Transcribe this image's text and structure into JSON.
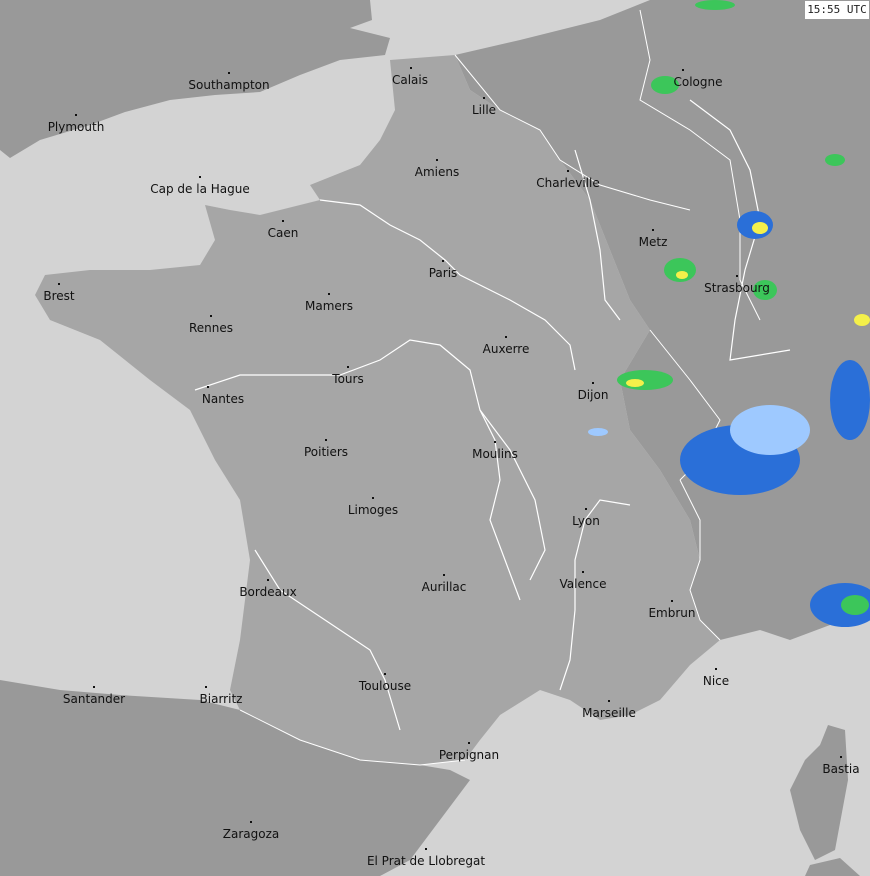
{
  "timestamp": "15:55 UTC",
  "colors": {
    "sea": "#d3d3d3",
    "france": "#a6a6a6",
    "neighbors": "#999999",
    "rivers": "#ffffff",
    "borders": "#ffffff",
    "radar_light": "#9ec9ff",
    "radar_mid": "#2a6fd8",
    "radar_green": "#3cc65a",
    "radar_yellow": "#f4f04a"
  },
  "cities": [
    {
      "id": "southampton",
      "name": "Southampton"
    },
    {
      "id": "plymouth",
      "name": "Plymouth"
    },
    {
      "id": "calais",
      "name": "Calais"
    },
    {
      "id": "lille",
      "name": "Lille"
    },
    {
      "id": "cologne",
      "name": "Cologne"
    },
    {
      "id": "amiens",
      "name": "Amiens"
    },
    {
      "id": "charleville",
      "name": "Charleville"
    },
    {
      "id": "cap-de-la-hague",
      "name": "Cap de la Hague"
    },
    {
      "id": "caen",
      "name": "Caen"
    },
    {
      "id": "metz",
      "name": "Metz"
    },
    {
      "id": "paris",
      "name": "Paris"
    },
    {
      "id": "strasbourg",
      "name": "Strasbourg"
    },
    {
      "id": "brest",
      "name": "Brest"
    },
    {
      "id": "mamers",
      "name": "Mamers"
    },
    {
      "id": "rennes",
      "name": "Rennes"
    },
    {
      "id": "auxerre",
      "name": "Auxerre"
    },
    {
      "id": "tours",
      "name": "Tours"
    },
    {
      "id": "dijon",
      "name": "Dijon"
    },
    {
      "id": "nantes",
      "name": "Nantes"
    },
    {
      "id": "poitiers",
      "name": "Poitiers"
    },
    {
      "id": "moulins",
      "name": "Moulins"
    },
    {
      "id": "limoges",
      "name": "Limoges"
    },
    {
      "id": "lyon",
      "name": "Lyon"
    },
    {
      "id": "valence",
      "name": "Valence"
    },
    {
      "id": "aurillac",
      "name": "Aurillac"
    },
    {
      "id": "bordeaux",
      "name": "Bordeaux"
    },
    {
      "id": "embrun",
      "name": "Embrun"
    },
    {
      "id": "nice",
      "name": "Nice"
    },
    {
      "id": "santander",
      "name": "Santander"
    },
    {
      "id": "biarritz",
      "name": "Biarritz"
    },
    {
      "id": "toulouse",
      "name": "Toulouse"
    },
    {
      "id": "marseille",
      "name": "Marseille"
    },
    {
      "id": "perpignan",
      "name": "Perpignan"
    },
    {
      "id": "bastia",
      "name": "Bastia"
    },
    {
      "id": "zaragoza",
      "name": "Zaragoza"
    },
    {
      "id": "el-prat",
      "name": "El Prat de Llobregat"
    }
  ]
}
